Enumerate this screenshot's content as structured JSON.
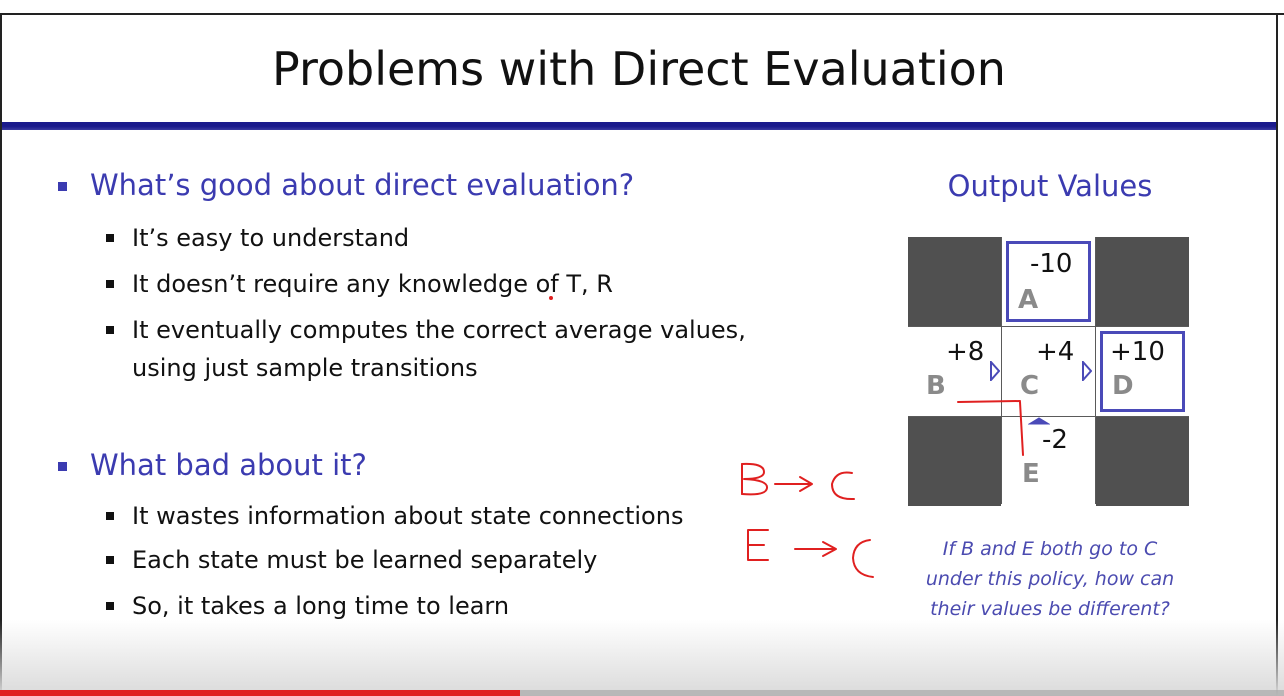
{
  "slide": {
    "title": "Problems with Direct Evaluation",
    "sections": [
      {
        "heading": "What’s good about direct evaluation?",
        "items": [
          "It’s easy to understand",
          "It doesn’t require any knowledge of T, R",
          "It eventually computes the correct average values,",
          "using just sample transitions"
        ]
      },
      {
        "heading": "What bad about it?",
        "items": [
          "It wastes information about state connections",
          "Each state must be learned separately",
          "So, it takes a long time to learn"
        ]
      }
    ]
  },
  "output_values": {
    "title": "Output Values",
    "cells": {
      "A": {
        "value": "-10",
        "label": "A"
      },
      "B": {
        "value": "+8",
        "label": "B"
      },
      "C": {
        "value": "+4",
        "label": "C"
      },
      "D": {
        "value": "+10",
        "label": "D"
      },
      "E": {
        "value": "-2",
        "label": "E"
      }
    },
    "caption": [
      "If B and E both go to C",
      "under this policy, how can",
      "their values be different?"
    ]
  },
  "video": {
    "progress_fraction": 0.405
  },
  "colors": {
    "title_bar": "#1a1a8c",
    "heading": "#3b3bb0",
    "annotation": "#e02020",
    "grid_dark": "#505050",
    "box_outline": "#4a4ab8"
  }
}
